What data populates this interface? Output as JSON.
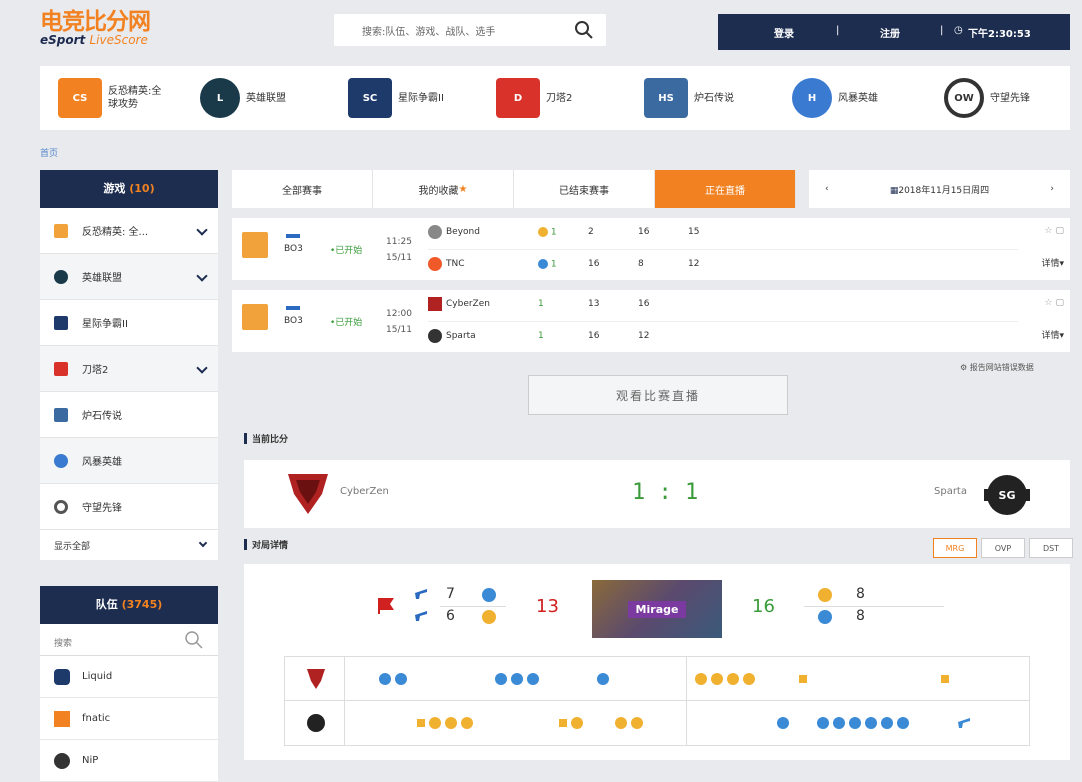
{
  "header": {
    "logo_cn": "电竞比分网",
    "logo_en_1": "eSport",
    "logo_en_2": "LiveScore",
    "search_placeholder": "搜索:队伍、游戏、战队、选手",
    "login": "登录",
    "register": "注册",
    "time": "下午2:30:53"
  },
  "games": [
    {
      "name": "反恐精英:全球攻势",
      "icon": "csgo-icon",
      "color": "#f28221"
    },
    {
      "name": "英雄联盟",
      "icon": "lol-icon",
      "color": "#1a3a4a"
    },
    {
      "name": "星际争霸II",
      "icon": "sc2-icon",
      "color": "#1d3a6a"
    },
    {
      "name": "刀塔2",
      "icon": "dota2-icon",
      "color": "#d8322a"
    },
    {
      "name": "炉石传说",
      "icon": "hearthstone-icon",
      "color": "#3a6aa0"
    },
    {
      "name": "风暴英雄",
      "icon": "heroes-icon",
      "color": "#3a7ad0"
    },
    {
      "name": "守望先锋",
      "icon": "overwatch-icon",
      "color": "#333333"
    }
  ],
  "breadcrumb": "首页",
  "sidebar": {
    "games_title": "游戏",
    "games_count": "(10)",
    "items": [
      {
        "label": "反恐精英: 全...",
        "color": "#f2a23a",
        "chev": true
      },
      {
        "label": "英雄联盟",
        "color": "#1a3a4a",
        "chev": true
      },
      {
        "label": "星际争霸II",
        "color": "#1d3a6a",
        "chev": false
      },
      {
        "label": "刀塔2",
        "color": "#d8322a",
        "chev": true
      },
      {
        "label": "炉石传说",
        "color": "#3a6aa0",
        "chev": false
      },
      {
        "label": "风暴英雄",
        "color": "#3a7ad0",
        "chev": false
      },
      {
        "label": "守望先锋",
        "color": "#555555",
        "chev": false
      }
    ],
    "show_all": "显示全部",
    "teams_title": "队伍",
    "teams_count": "(3745)",
    "team_search": "搜索",
    "teams": [
      {
        "name": "Liquid",
        "color": "#1d3a6a"
      },
      {
        "name": "fnatic",
        "color": "#f28221"
      },
      {
        "name": "NiP",
        "color": "#333333"
      }
    ]
  },
  "tabs": [
    "全部赛事",
    "我的收藏",
    "已结束赛事",
    "正在直播"
  ],
  "fav_star": "★",
  "date": "2018年11月15日周四",
  "matches": [
    {
      "bo": "BO3",
      "status": "•已开始",
      "time": "11:25",
      "date": "15/11",
      "teams": [
        {
          "name": "Beyond",
          "map_score": "1",
          "scores": [
            "2",
            "16",
            "15"
          ]
        },
        {
          "name": "TNC",
          "map_score": "1",
          "scores": [
            "16",
            "8",
            "12"
          ]
        }
      ],
      "detail": "详情"
    },
    {
      "bo": "BO3",
      "status": "•已开始",
      "time": "12:00",
      "date": "15/11",
      "teams": [
        {
          "name": "CyberZen",
          "map_score": "1",
          "scores": [
            "13",
            "16"
          ]
        },
        {
          "name": "Sparta",
          "map_score": "1",
          "scores": [
            "16",
            "12"
          ]
        }
      ],
      "detail": "详情"
    }
  ],
  "report_error": "报告网站错误数据",
  "watch_live": "观看比赛直播",
  "current_score": {
    "title": "当前比分",
    "team1": "CyberZen",
    "team2": "Sparta",
    "score": "1 : 1"
  },
  "duel": {
    "title": "对局详情",
    "map_buttons": [
      "MRG",
      "OVP",
      "DST"
    ],
    "map_name": "Mirage",
    "t_half": "7",
    "ct_half": "6",
    "left_score": "13",
    "right_score": "16",
    "right_t": "8",
    "right_ct": "8"
  }
}
